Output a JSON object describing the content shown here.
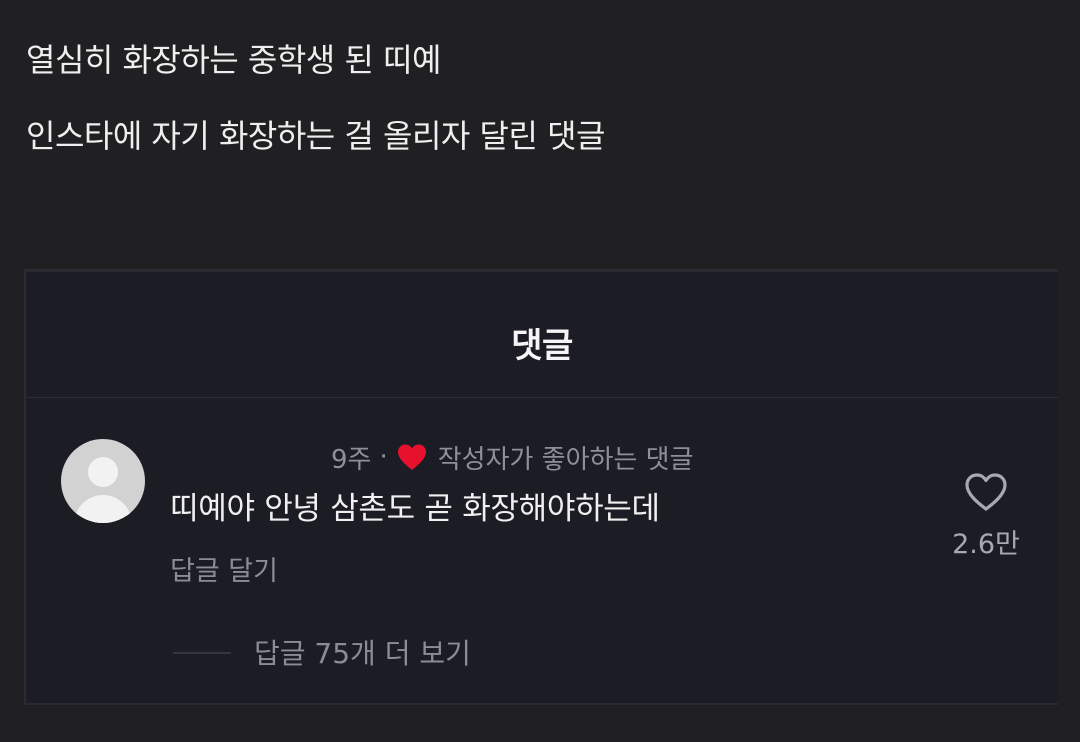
{
  "post": {
    "line1": "열심히 화장하는 중학생 된 띠예",
    "line2": "인스타에 자기 화장하는 걸 올리자 달린 댓글"
  },
  "screenshot": {
    "sheet_title": "댓글",
    "comment": {
      "time_ago": "9주",
      "separator": "·",
      "creator_liked_label": "작성자가 좋아하는 댓글",
      "text": "띠예야 안녕 삼촌도 곧 화장해야하는데",
      "reply_label": "답글 달기",
      "like_count": "2.6만",
      "view_replies_label": "답글 75개 더 보기"
    },
    "icons": {
      "avatar": "default-avatar-icon",
      "creator_heart": "heart-filled-icon",
      "like": "heart-outline-icon"
    },
    "colors": {
      "page_background": "#202022",
      "sheet_background": "#1c1d24",
      "creator_heart": "#e8112d",
      "muted_text": "#8b8c94"
    }
  }
}
